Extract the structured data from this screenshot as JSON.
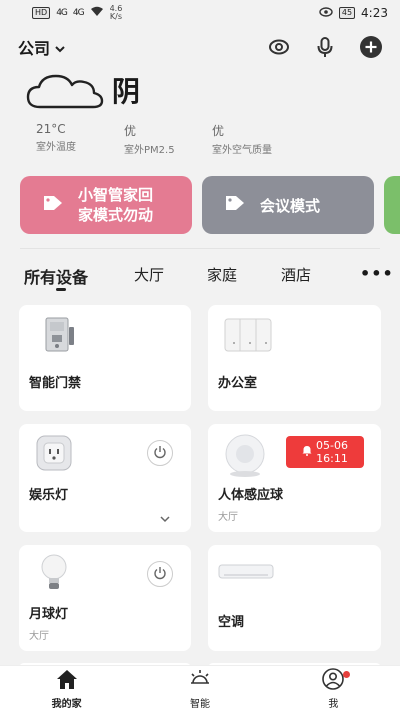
{
  "status_bar": {
    "hd_label": "HD",
    "signal1": "4G",
    "signal2": "4G",
    "net_speed_value": "4.6",
    "net_speed_unit": "K/s",
    "battery": "45",
    "time": "4:23"
  },
  "header": {
    "home_name": "公司",
    "icons": [
      "camera-eye-icon",
      "microphone-icon",
      "add-icon"
    ]
  },
  "weather": {
    "condition": "阴",
    "stats": [
      {
        "value": "21°C",
        "label": "室外温度"
      },
      {
        "value": "优",
        "label": "室外PM2.5"
      },
      {
        "value": "优",
        "label": "室外空气质量"
      }
    ]
  },
  "scenes": [
    {
      "line1": "小智管家回",
      "line2": "家模式勿动",
      "color": "#e47b92"
    },
    {
      "line1": "会议模式",
      "line2": "",
      "color": "#8d8f98"
    },
    {
      "line1": "",
      "line2": "",
      "color": "#7bbf6a"
    }
  ],
  "tabs": [
    {
      "label": "所有设备",
      "active": true
    },
    {
      "label": "大厅",
      "active": false
    },
    {
      "label": "家庭",
      "active": false
    },
    {
      "label": "酒店",
      "active": false
    }
  ],
  "more_label": "•••",
  "devices": [
    {
      "name": "智能门禁",
      "room": "",
      "icon": "access-control-icon"
    },
    {
      "name": "办公室",
      "room": "",
      "icon": "wall-switch-icon"
    },
    {
      "name": "娱乐灯",
      "room": "",
      "icon": "smart-plug-icon"
    },
    {
      "name": "人体感应球",
      "room": "大厅",
      "icon": "motion-sensor-icon",
      "alert_date": "05-06",
      "alert_time": "16:11"
    },
    {
      "name": "月球灯",
      "room": "大厅",
      "icon": "light-bulb-icon"
    },
    {
      "name": "空调",
      "room": "",
      "icon": "air-conditioner-icon"
    }
  ],
  "bottom_nav": [
    {
      "label": "我的家",
      "icon": "home-icon",
      "active": true
    },
    {
      "label": "智能",
      "icon": "smart-sun-icon",
      "active": false
    },
    {
      "label": "我",
      "icon": "profile-icon",
      "active": false
    }
  ],
  "colors": {
    "alert": "#ee3b3b",
    "notification_dot": "#e5403d"
  }
}
